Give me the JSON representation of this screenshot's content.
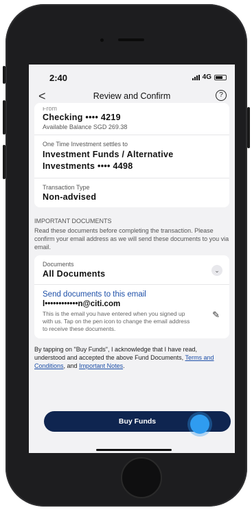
{
  "status_bar": {
    "time": "2:40",
    "network": "4G"
  },
  "header": {
    "back": "<",
    "title": "Review and Confirm",
    "help": "?"
  },
  "from": {
    "label": "From",
    "account": "Checking •••• 4219",
    "balance": "Available Balance SGD 269.38"
  },
  "to": {
    "label": "One Time Investment settles to",
    "account": "Investment Funds / Alternative Investments •••• 4498"
  },
  "transaction": {
    "label": "Transaction Type",
    "value": "Non-advised"
  },
  "important_docs": {
    "heading": "IMPORTANT DOCUMENTS",
    "text": "Read these documents before completing the transaction. Please confirm your email address as we will send these documents to you via email."
  },
  "documents": {
    "label": "Documents",
    "value": "All Documents"
  },
  "email": {
    "title": "Send documents to this email",
    "value": "l••••••••••••n@citi.com",
    "description": "This is the email you have entered when you signed up with us. Tap on the pen icon to change the email address to receive these documents."
  },
  "acknowledgement": {
    "part1": "By tapping on \"Buy Funds\", I acknowledge that I have read, understood and accepted the above Fund Documents, ",
    "terms": "Terms and Conditions",
    "part2": ", and ",
    "notes": "Important Notes",
    "part3": "."
  },
  "buy_button": {
    "label": "Buy Funds"
  },
  "colors": {
    "primary": "#0f2550",
    "link": "#1d4fa8",
    "touch": "#2f9cf0"
  }
}
